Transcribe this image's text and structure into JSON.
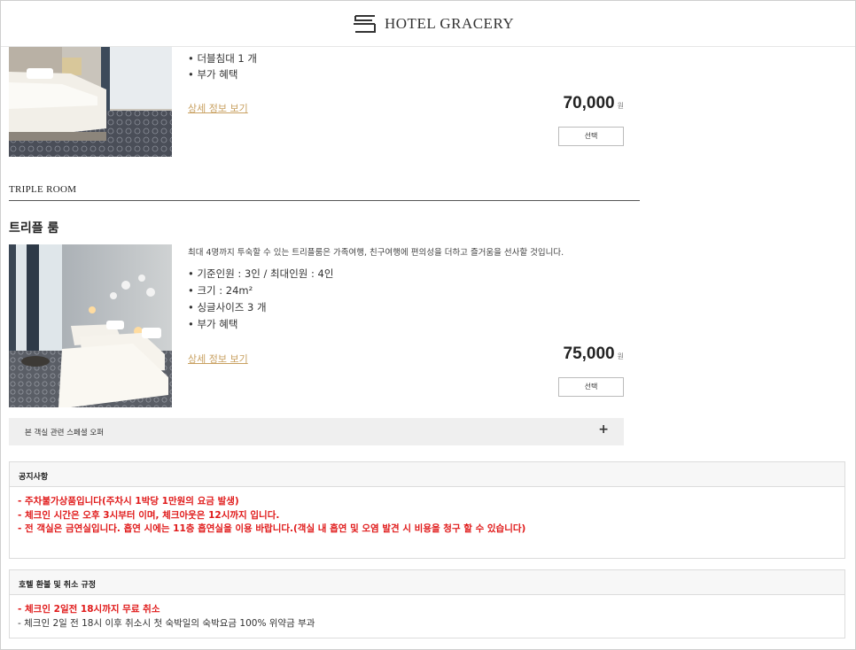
{
  "header": {
    "brand": "HOTEL GRACERY"
  },
  "room1": {
    "features": [
      "더블침대 1 개",
      "부가 혜택"
    ],
    "detail_link": "상세 정보 보기",
    "price": "70,000",
    "currency": "원",
    "select_label": "선택"
  },
  "section": {
    "title": "TRIPLE ROOM"
  },
  "room2": {
    "name": "트리플 룸",
    "description": "최대 4명까지 투숙할 수 있는 트리플룸은 가족여행, 친구여행에 편의성을 더하고 즐거움을 선사할 것입니다.",
    "features": [
      "기준인원 : 3인 / 최대인원 : 4인",
      "크기 : 24m²",
      "싱글사이즈 3 개",
      "부가 혜택"
    ],
    "detail_link": "상세 정보 보기",
    "price": "75,000",
    "currency": "원",
    "select_label": "선택",
    "offer_label": "본 객실 관련 스페셜 오퍼",
    "offer_toggle": "+"
  },
  "notice": {
    "title": "공지사항",
    "lines": [
      "- 주차불가상품입니다(주차시 1박당 1만원의 요금 발생)",
      "- 체크인 시간은 오후 3시부터 이며, 체크아웃은 12시까지 입니다.",
      "- 전 객실은 금연실입니다. 흡연 시에는 11층 흡연실을 이용 바랍니다.(객실 내 흡연 및 오염 발견 시 비용을 청구 할 수 있습니다)"
    ]
  },
  "refund": {
    "title": "호텔 환불 및 취소 규정",
    "line_free": "- 체크인 2일전 18시까지 무료 취소",
    "line_fee": "- 체크인 2일 전 18시 이후 취소시 첫 숙박일의 숙박요금 100% 위약금 부과"
  },
  "colors": {
    "link_gold": "#c8a060",
    "notice_red": "#e01a1a"
  }
}
